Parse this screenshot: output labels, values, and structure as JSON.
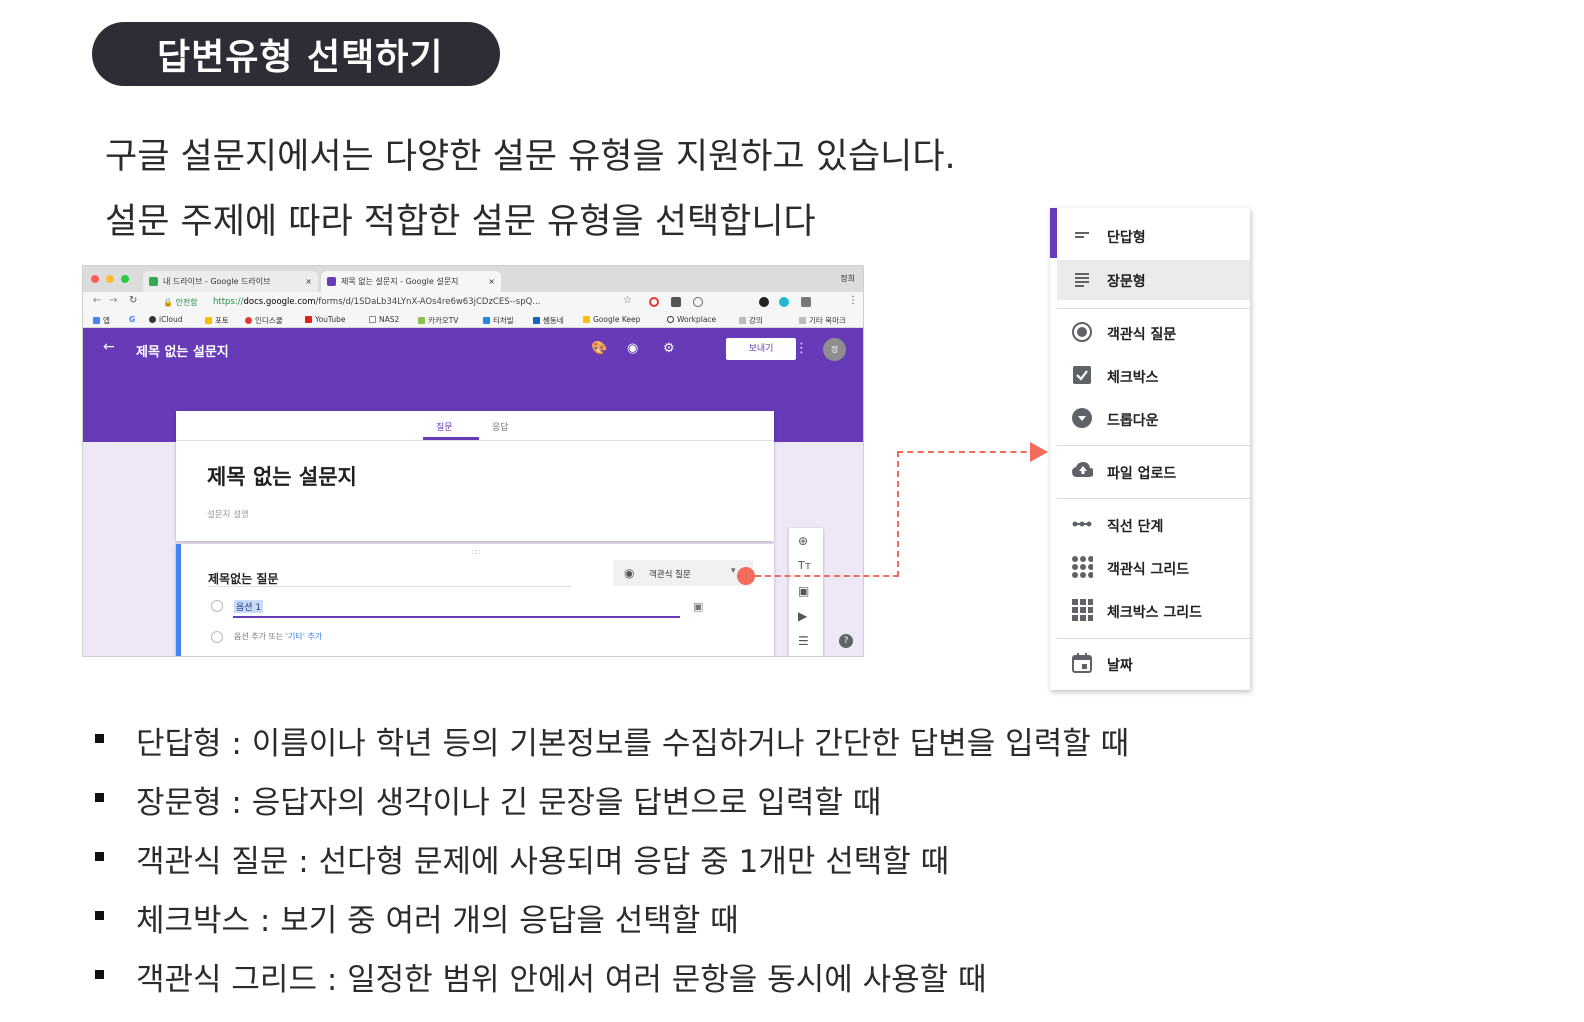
{
  "heading": "답변유형 선택하기",
  "intro": {
    "line1": "구글 설문지에서는 다양한 설문 유형을 지원하고 있습니다.",
    "line2": "설문 주제에 따라 적합한 설문 유형을 선택합니다"
  },
  "browser": {
    "tabs": [
      {
        "label": "내 드라이브 - Google 드라이브",
        "close": "×"
      },
      {
        "label": "제목 없는 설문지 - Google 설문지",
        "close": "×"
      }
    ],
    "profile": "정희",
    "secure_label": "안전함",
    "url_prefix": "https://",
    "url_host": "docs.google.com",
    "url_path": "/forms/d/1SDaLb34LYnX-AOs4re6w63jCDzCES--spQ...",
    "bookmarks": [
      "앱",
      "G",
      "iCloud",
      "포토",
      "인디스쿨",
      "YouTube",
      "NAS2",
      "카카오TV",
      "티처빌",
      "쌤동네",
      "Google Keep",
      "Workplace",
      "강의",
      "기타 북마크"
    ]
  },
  "forms": {
    "title_bar": "제목 없는 설문지",
    "send_label": "보내기",
    "avatar_label": "정",
    "tabs": {
      "questions": "질문",
      "responses": "응답"
    },
    "form_title": "제목 없는 설문지",
    "form_desc": "설문지 설명",
    "drag_handle": ":::",
    "question_title": "제목없는 질문",
    "question_type": "객관식 질문",
    "option1": "옵션 1",
    "add_option_prefix": "옵션 추가 또는 ",
    "add_other": "'기타' 추가",
    "help": "?"
  },
  "menu": {
    "items": [
      {
        "label": "단답형",
        "icon": "short-answer-icon"
      },
      {
        "label": "장문형",
        "icon": "paragraph-icon"
      },
      {
        "label": "객관식 질문",
        "icon": "radio-icon"
      },
      {
        "label": "체크박스",
        "icon": "checkbox-icon"
      },
      {
        "label": "드롭다운",
        "icon": "dropdown-icon"
      },
      {
        "label": "파일 업로드",
        "icon": "cloud-upload-icon"
      },
      {
        "label": "직선 단계",
        "icon": "linear-scale-icon"
      },
      {
        "label": "객관식 그리드",
        "icon": "grid-icon"
      },
      {
        "label": "체크박스 그리드",
        "icon": "checkbox-grid-icon"
      },
      {
        "label": "날짜",
        "icon": "calendar-icon"
      }
    ],
    "highlighted": "장문형"
  },
  "bullets": [
    "단답형 : 이름이나 학년 등의 기본정보를 수집하거나 간단한 답변을 입력할 때",
    "장문형 : 응답자의 생각이나 긴 문장을 답변으로 입력할 때",
    "객관식 질문 : 선다형 문제에 사용되며 응답 중 1개만 선택할 때",
    "체크박스 : 보기 중 여러 개의 응답을 선택할 때",
    "객관식 그리드 : 일정한 범위 안에서 여러 문항을 동시에 사용할 때"
  ],
  "colors": {
    "forms_purple": "#673ab7",
    "pill_bg": "#2d2e35",
    "arrow": "#f26b5b",
    "question_accent": "#4285f4"
  }
}
